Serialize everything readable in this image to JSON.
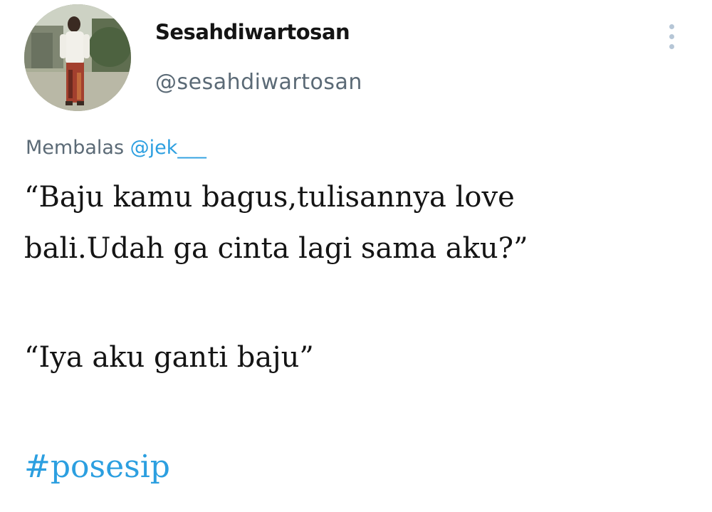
{
  "tweet": {
    "display_name": "Sesahdiwartosan",
    "handle": "@sesahdiwartosan",
    "reply_prefix": "Membalas",
    "reply_mention": "@jek___",
    "text_lines": [
      "“Baju kamu bagus,tulisannya love",
      "bali.Udah ga cinta lagi sama aku?”",
      "“Iya aku ganti baju”"
    ],
    "hashtag": "#posesip"
  },
  "icons": {
    "avatar": "profile-photo",
    "more": "more-vertical-icon"
  },
  "colors": {
    "text": "#141414",
    "secondary": "#5b6a76",
    "link": "#2c9fe0",
    "more_dots": "#b6c6d6",
    "background": "#ffffff"
  }
}
